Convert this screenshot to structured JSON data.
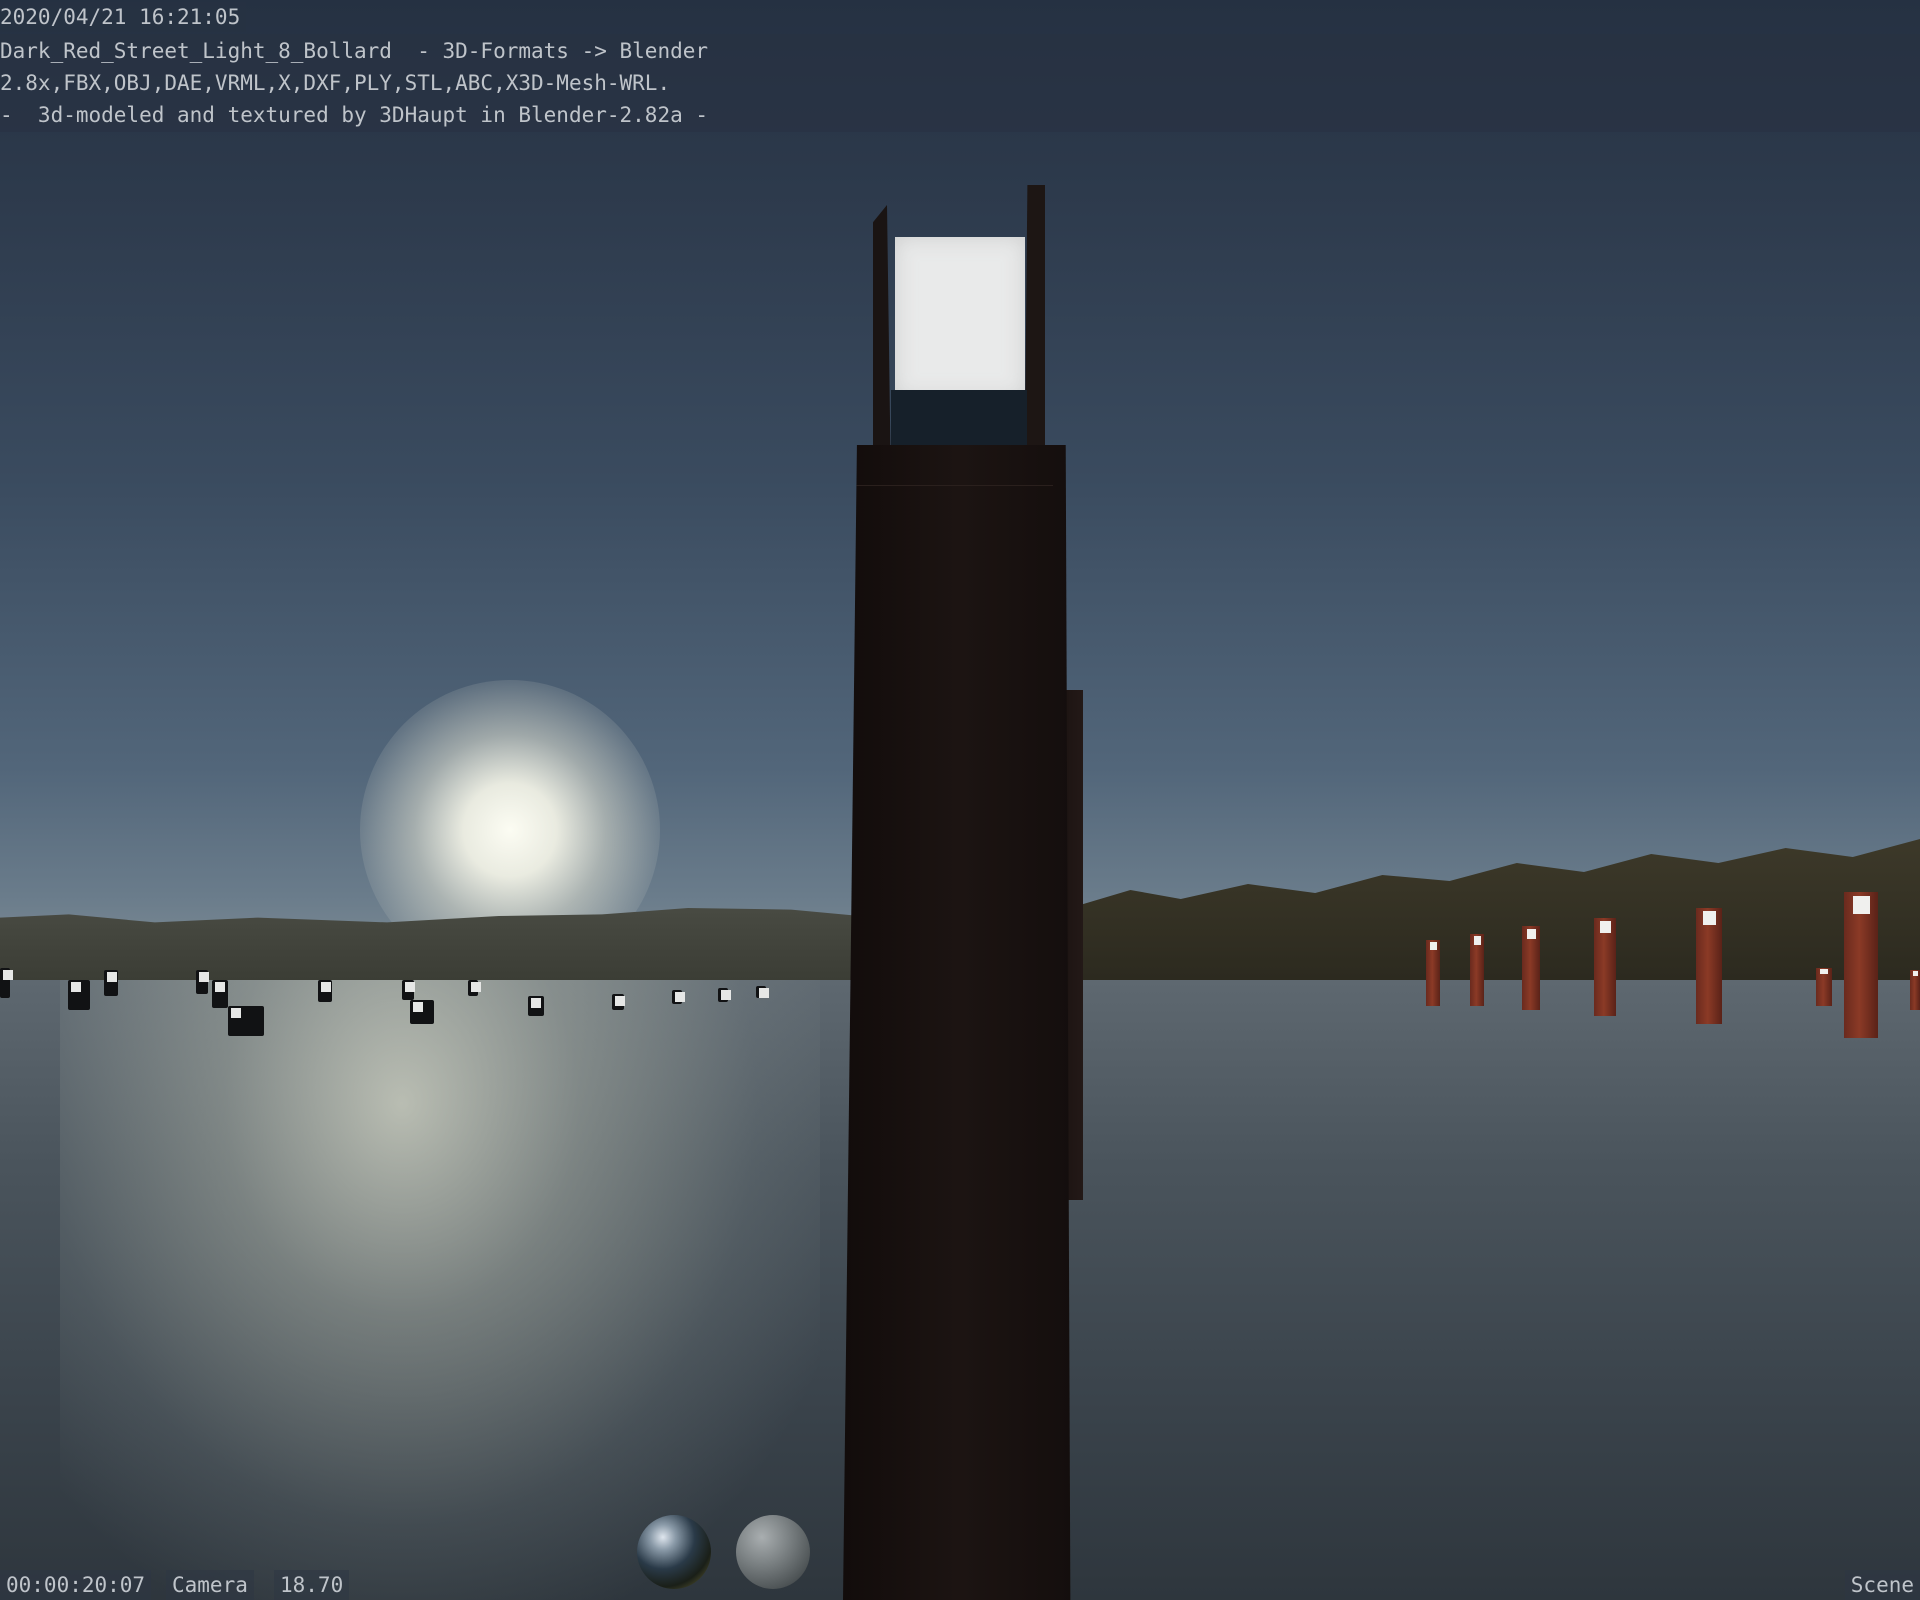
{
  "overlay": {
    "timestamp": "2020/04/21 16:21:05",
    "line1": "Dark_Red_Street_Light_8_Bollard  - 3D-Formats -> Blender",
    "line2": "2.8x,FBX,OBJ,DAE,VRML,X,DXF,PLY,STL,ABC,X3D-Mesh-WRL.",
    "line3": "-  3d-modeled and textured by 3DHaupt in Blender-2.82a -"
  },
  "footer": {
    "time": "00:00:20:07",
    "camera": "Camera",
    "focal": "18.70",
    "scene": "Scene"
  },
  "colors": {
    "overlay_text": "#bfc4ca",
    "bollard_red": "#8b3a26",
    "bollard_dark": "#1c1412",
    "lamp_white": "#e9eaea"
  },
  "icons": {
    "reflective_sphere": "matcap-reflective-sphere-icon",
    "diffuse_sphere": "matcap-diffuse-sphere-icon"
  }
}
